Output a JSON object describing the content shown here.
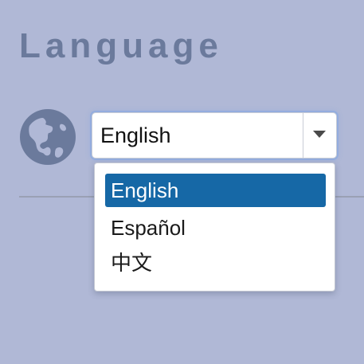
{
  "page": {
    "title": "Language"
  },
  "language_selector": {
    "icon": "globe-icon",
    "selected_value": "English",
    "options": [
      {
        "label": "English",
        "selected": true
      },
      {
        "label": "Español",
        "selected": false
      },
      {
        "label": "中文",
        "selected": false
      }
    ]
  },
  "colors": {
    "background": "#b0b8d6",
    "title": "#6b7a9c",
    "globe": "#6b7a9c",
    "highlight": "#1668a6"
  }
}
